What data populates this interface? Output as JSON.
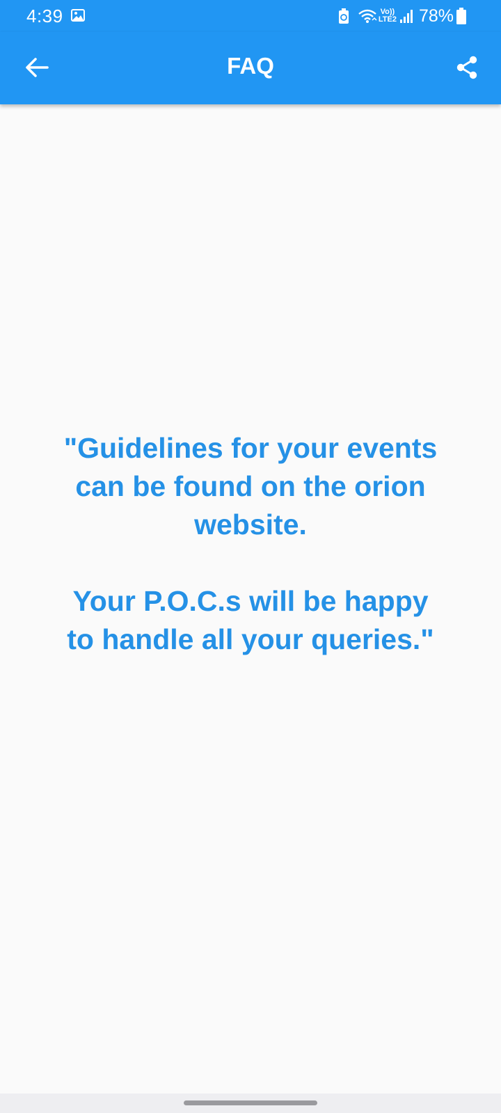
{
  "status_bar": {
    "time": "4:39",
    "battery_percent": "78%",
    "volte_top": "Vo))",
    "volte_bottom": "LTE2",
    "icons": [
      "gallery-icon",
      "battery-saver-icon",
      "wifi-icon",
      "volte-icon",
      "signal-icon",
      "battery-icon"
    ]
  },
  "app_bar": {
    "title": "FAQ",
    "back_icon": "arrow-left-icon",
    "share_icon": "share-icon"
  },
  "content": {
    "message": "\"Guidelines for your events\ncan be found on the orion\nwebsite.\n\nYour P.O.C.s will be happy\nto handle all your queries.\""
  },
  "colors": {
    "primary": "#2196f3",
    "message_text": "#2591e6",
    "background": "#fafafa"
  }
}
